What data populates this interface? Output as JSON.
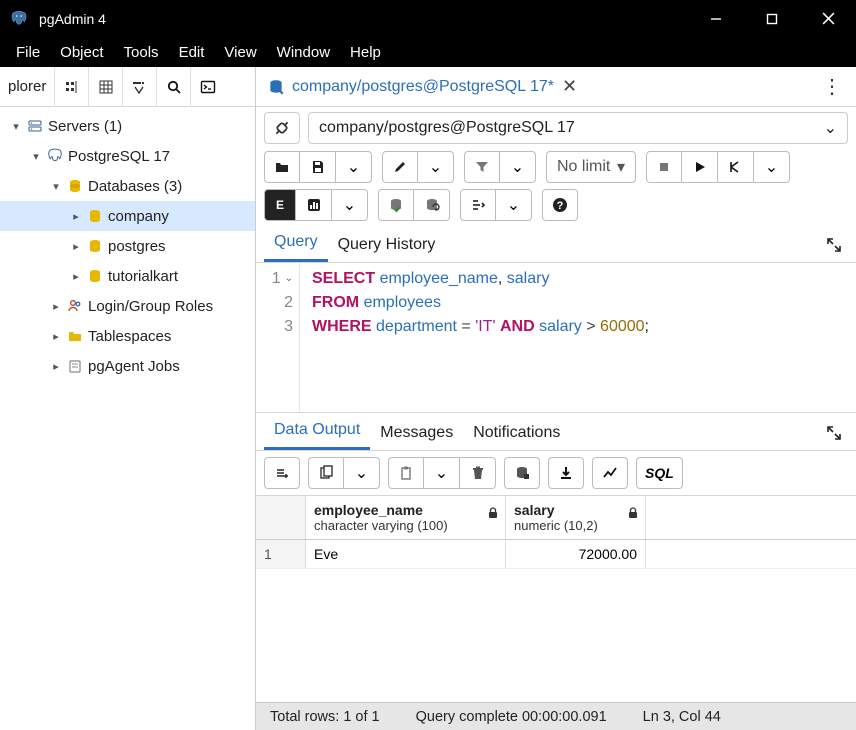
{
  "window": {
    "title": "pgAdmin 4"
  },
  "menu": [
    "File",
    "Object",
    "Tools",
    "Edit",
    "View",
    "Window",
    "Help"
  ],
  "sidebar": {
    "label": "plorer",
    "servers_label": "Servers (1)",
    "pg_label": "PostgreSQL 17",
    "db_label": "Databases (3)",
    "databases": [
      "company",
      "postgres",
      "tutorialkart"
    ],
    "login_label": "Login/Group Roles",
    "tablespaces_label": "Tablespaces",
    "pgagent_label": "pgAgent Jobs"
  },
  "tab": {
    "label": "company/postgres@PostgreSQL 17*"
  },
  "connection": {
    "text": "company/postgres@PostgreSQL 17"
  },
  "toolbar": {
    "limit": "No limit"
  },
  "query_tabs": {
    "query": "Query",
    "history": "Query History"
  },
  "sql": {
    "line1": {
      "kw1": "SELECT",
      "id1": "employee_name",
      "id2": "salary"
    },
    "line2": {
      "kw1": "FROM",
      "id1": "employees"
    },
    "line3": {
      "kw1": "WHERE",
      "id1": "department",
      "str": "'IT'",
      "kw2": "AND",
      "id2": "salary",
      "num": "60000"
    }
  },
  "output_tabs": {
    "data": "Data Output",
    "messages": "Messages",
    "notifications": "Notifications"
  },
  "out_buttons": {
    "sql": "SQL"
  },
  "grid": {
    "col1": {
      "name": "employee_name",
      "type": "character varying (100)"
    },
    "col2": {
      "name": "salary",
      "type": "numeric (10,2)"
    },
    "rows": [
      {
        "n": "1",
        "employee_name": "Eve",
        "salary": "72000.00"
      }
    ]
  },
  "status": {
    "rows": "Total rows: 1 of 1",
    "time": "Query complete 00:00:00.091",
    "pos": "Ln 3, Col 44"
  }
}
